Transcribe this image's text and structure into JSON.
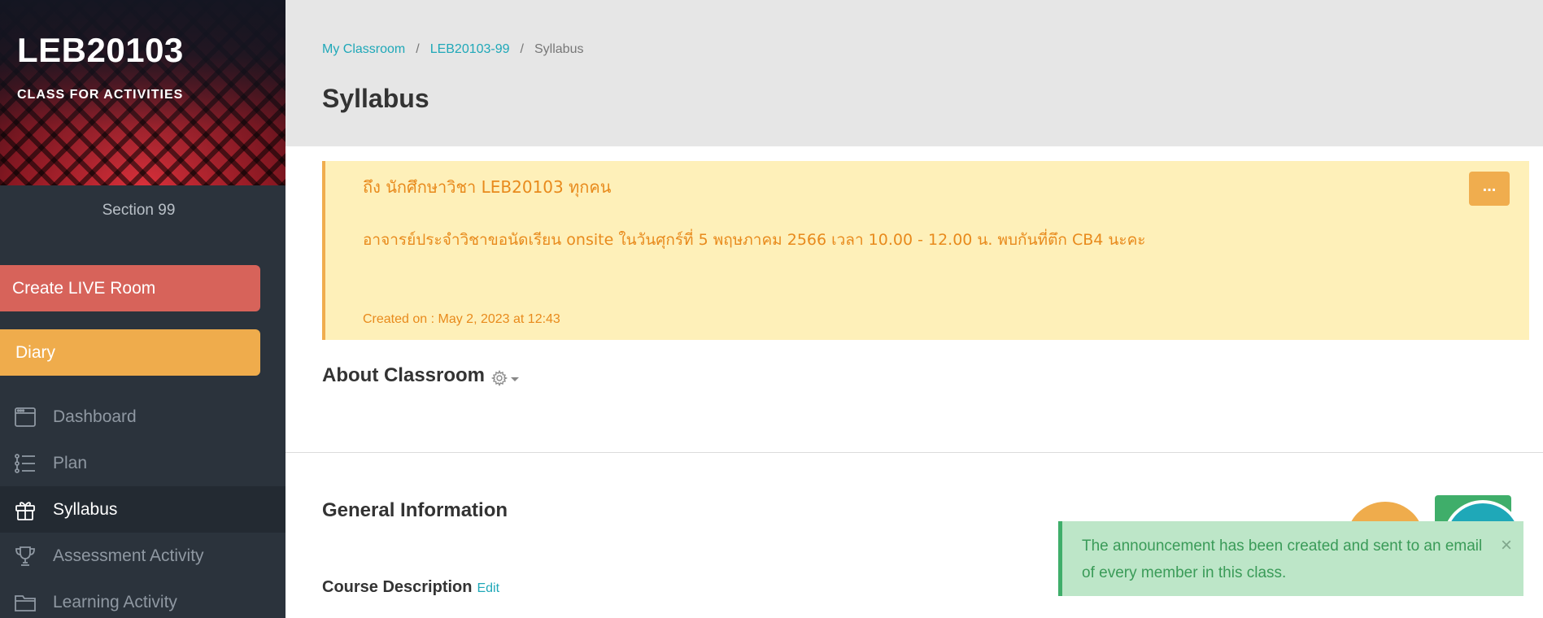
{
  "sidebar": {
    "class_code": "LEB20103",
    "class_subtitle": "CLASS FOR ACTIVITIES",
    "section": "Section 99",
    "create_live_room": "Create LIVE Room",
    "diary": "Diary",
    "nav": [
      {
        "label": "Dashboard",
        "icon": "window-icon",
        "active": false
      },
      {
        "label": "Plan",
        "icon": "list-icon",
        "active": false
      },
      {
        "label": "Syllabus",
        "icon": "gift-icon",
        "active": true
      },
      {
        "label": "Assessment Activity",
        "icon": "trophy-icon",
        "active": false
      },
      {
        "label": "Learning Activity",
        "icon": "folder-icon",
        "active": false
      }
    ]
  },
  "breadcrumb": {
    "items": [
      "My Classroom",
      "LEB20103-99",
      "Syllabus"
    ],
    "separator": "/"
  },
  "page": {
    "title": "Syllabus"
  },
  "announcement": {
    "line1": "ถึง นักศึกษาวิชา LEB20103 ทุกคน",
    "line2": "อาจารย์ประจำวิชาขอนัดเรียน onsite ในวันศุกร์ที่ 5 พฤษภาคม 2566 เวลา 10.00 - 12.00 น. พบกันที่ตึก CB4 นะคะ",
    "created": "Created on : May 2, 2023 at 12:43",
    "more_label": "..."
  },
  "about": {
    "title": "About Classroom"
  },
  "general": {
    "title": "General Information",
    "course_description": "Course Description",
    "edit": "Edit"
  },
  "toast": {
    "message": "The announcement has been created and sent to an email of every member in this class.",
    "close": "×"
  },
  "colors": {
    "sidebar_bg": "#2b333c",
    "live_button": "#d7635a",
    "diary_button": "#efac4c",
    "link": "#1fa8b8",
    "announcement_bg": "#fef0b9",
    "announcement_text": "#e88a1c",
    "toast_bg": "#bde6c8",
    "toast_text": "#3a9b58"
  }
}
